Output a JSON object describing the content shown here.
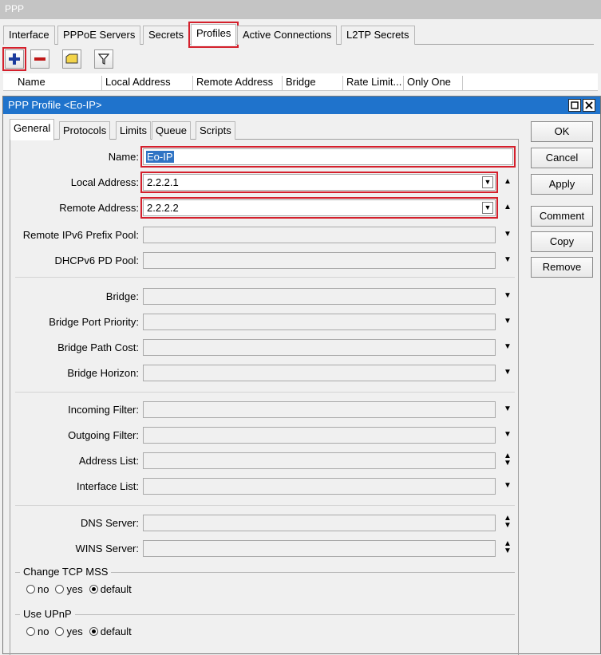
{
  "window": {
    "title": "PPP"
  },
  "tabs": [
    "Interface",
    "PPPoE Servers",
    "Secrets",
    "Profiles",
    "Active Connections",
    "L2TP Secrets"
  ],
  "toolbar": {
    "add_icon": "plus-icon",
    "remove_icon": "minus-icon",
    "comment_icon": "comment-icon",
    "filter_icon": "filter-icon"
  },
  "list": {
    "columns": [
      "Name",
      "Local Address",
      "Remote Address",
      "Bridge",
      "Rate Limit...",
      "Only One"
    ]
  },
  "dialog": {
    "title": "PPP Profile <Eo-IP>",
    "tabs": [
      "General",
      "Protocols",
      "Limits",
      "Queue",
      "Scripts"
    ],
    "fields": {
      "name": {
        "label": "Name:",
        "value": "Eo-IP"
      },
      "local_address": {
        "label": "Local Address:",
        "value": "2.2.2.1"
      },
      "remote_address": {
        "label": "Remote Address:",
        "value": "2.2.2.2"
      },
      "remote_ipv6_prefix_pool": {
        "label": "Remote IPv6 Prefix Pool:",
        "value": ""
      },
      "dhcpv6_pd_pool": {
        "label": "DHCPv6 PD Pool:",
        "value": ""
      },
      "bridge": {
        "label": "Bridge:",
        "value": ""
      },
      "bridge_port_priority": {
        "label": "Bridge Port Priority:",
        "value": ""
      },
      "bridge_path_cost": {
        "label": "Bridge Path Cost:",
        "value": ""
      },
      "bridge_horizon": {
        "label": "Bridge Horizon:",
        "value": ""
      },
      "incoming_filter": {
        "label": "Incoming Filter:",
        "value": ""
      },
      "outgoing_filter": {
        "label": "Outgoing Filter:",
        "value": ""
      },
      "address_list": {
        "label": "Address List:",
        "value": ""
      },
      "interface_list": {
        "label": "Interface List:",
        "value": ""
      },
      "dns_server": {
        "label": "DNS Server:",
        "value": ""
      },
      "wins_server": {
        "label": "WINS Server:",
        "value": ""
      }
    },
    "change_tcp_mss": {
      "label": "Change TCP MSS",
      "options": [
        "no",
        "yes",
        "default"
      ],
      "selected": "default"
    },
    "use_upnp": {
      "label": "Use UPnP",
      "options": [
        "no",
        "yes",
        "default"
      ],
      "selected": "default"
    },
    "buttons": {
      "ok": "OK",
      "cancel": "Cancel",
      "apply": "Apply",
      "comment": "Comment",
      "copy": "Copy",
      "remove": "Remove"
    }
  },
  "colors": {
    "highlight": "#d4202c",
    "dialog_titlebar": "#1f73cc",
    "add_icon": "#1a3a9c",
    "remove_icon": "#c01818",
    "comment_icon": "#f3d44a"
  }
}
